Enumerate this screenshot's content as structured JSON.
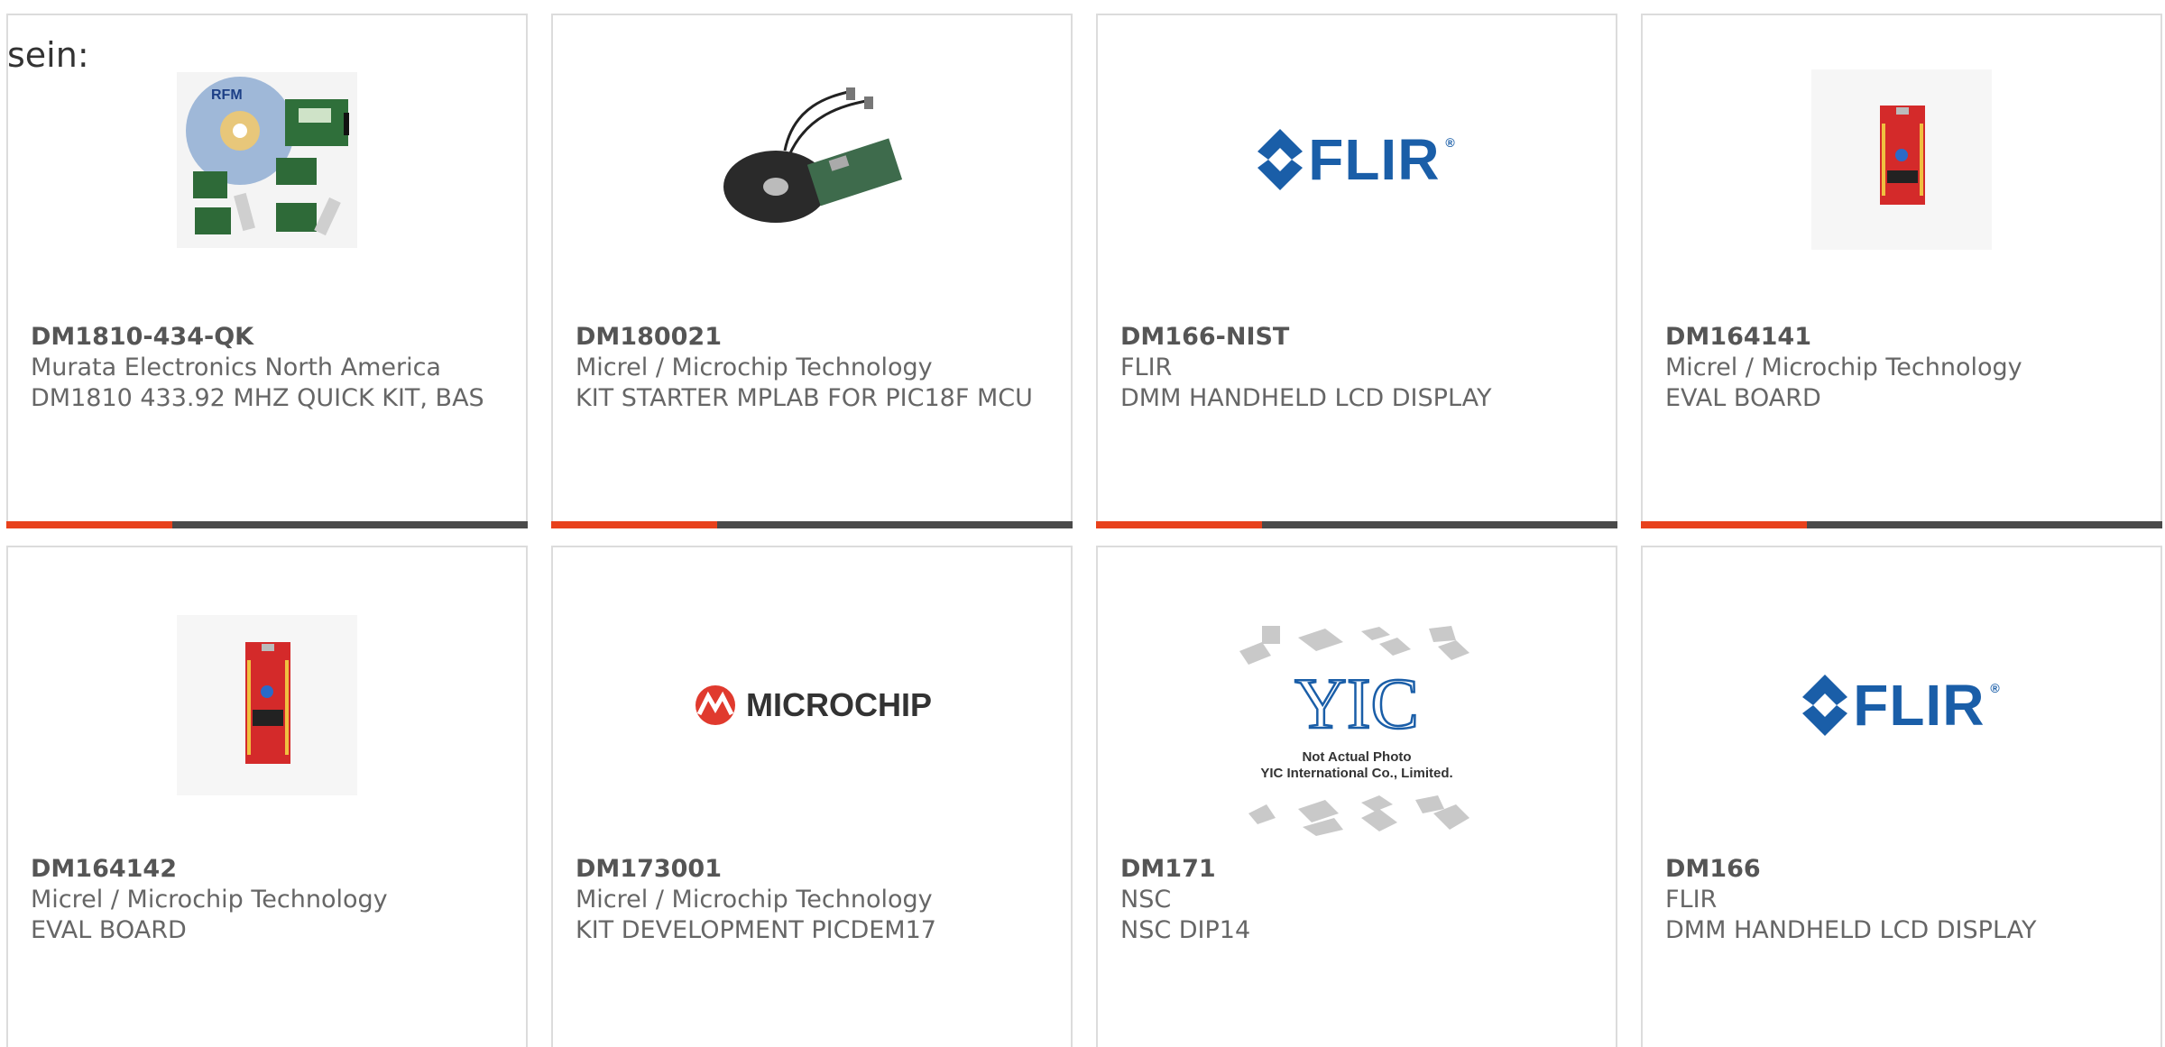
{
  "intro_text": "sein:",
  "products": [
    {
      "part_number": "DM1810-434-QK",
      "manufacturer": "Murata Electronics North America",
      "description": "DM1810 433.92 MHZ QUICK KIT, BAS",
      "image": "dev-kit-with-cd-photo",
      "image_label": "RFM"
    },
    {
      "part_number": "DM180021",
      "manufacturer": "Micrel / Microchip Technology",
      "description": "KIT STARTER MPLAB FOR PIC18F MCU",
      "image": "starter-kit-cd-board-photo"
    },
    {
      "part_number": "DM166-NIST",
      "manufacturer": "FLIR",
      "description": "DMM HANDHELD LCD DISPLAY",
      "image": "flir-logo",
      "image_label": "FLIR"
    },
    {
      "part_number": "DM164141",
      "manufacturer": "Micrel / Microchip Technology",
      "description": "EVAL BOARD",
      "image": "red-eval-board-photo"
    },
    {
      "part_number": "DM164142",
      "manufacturer": "Micrel / Microchip Technology",
      "description": "EVAL BOARD",
      "image": "red-eval-board-photo"
    },
    {
      "part_number": "DM173001",
      "manufacturer": "Micrel / Microchip Technology",
      "description": "KIT DEVELOPMENT PICDEM17",
      "image": "microchip-logo",
      "image_label": "MICROCHIP"
    },
    {
      "part_number": "DM171",
      "manufacturer": "NSC",
      "description": "NSC DIP14",
      "image": "not-actual-photo-placeholder",
      "image_label": "YIC",
      "image_caption_1": "Not Actual Photo",
      "image_caption_2": "YIC International Co., Limited."
    },
    {
      "part_number": "DM166",
      "manufacturer": "FLIR",
      "description": "DMM HANDHELD LCD DISPLAY",
      "image": "flir-logo",
      "image_label": "FLIR"
    }
  ],
  "colors": {
    "accent": "#e8411c",
    "bar_dark": "#4a4a4a",
    "flir_blue": "#1a5ea8",
    "microchip_red": "#e03a2e",
    "board_red": "#d42a2a"
  }
}
